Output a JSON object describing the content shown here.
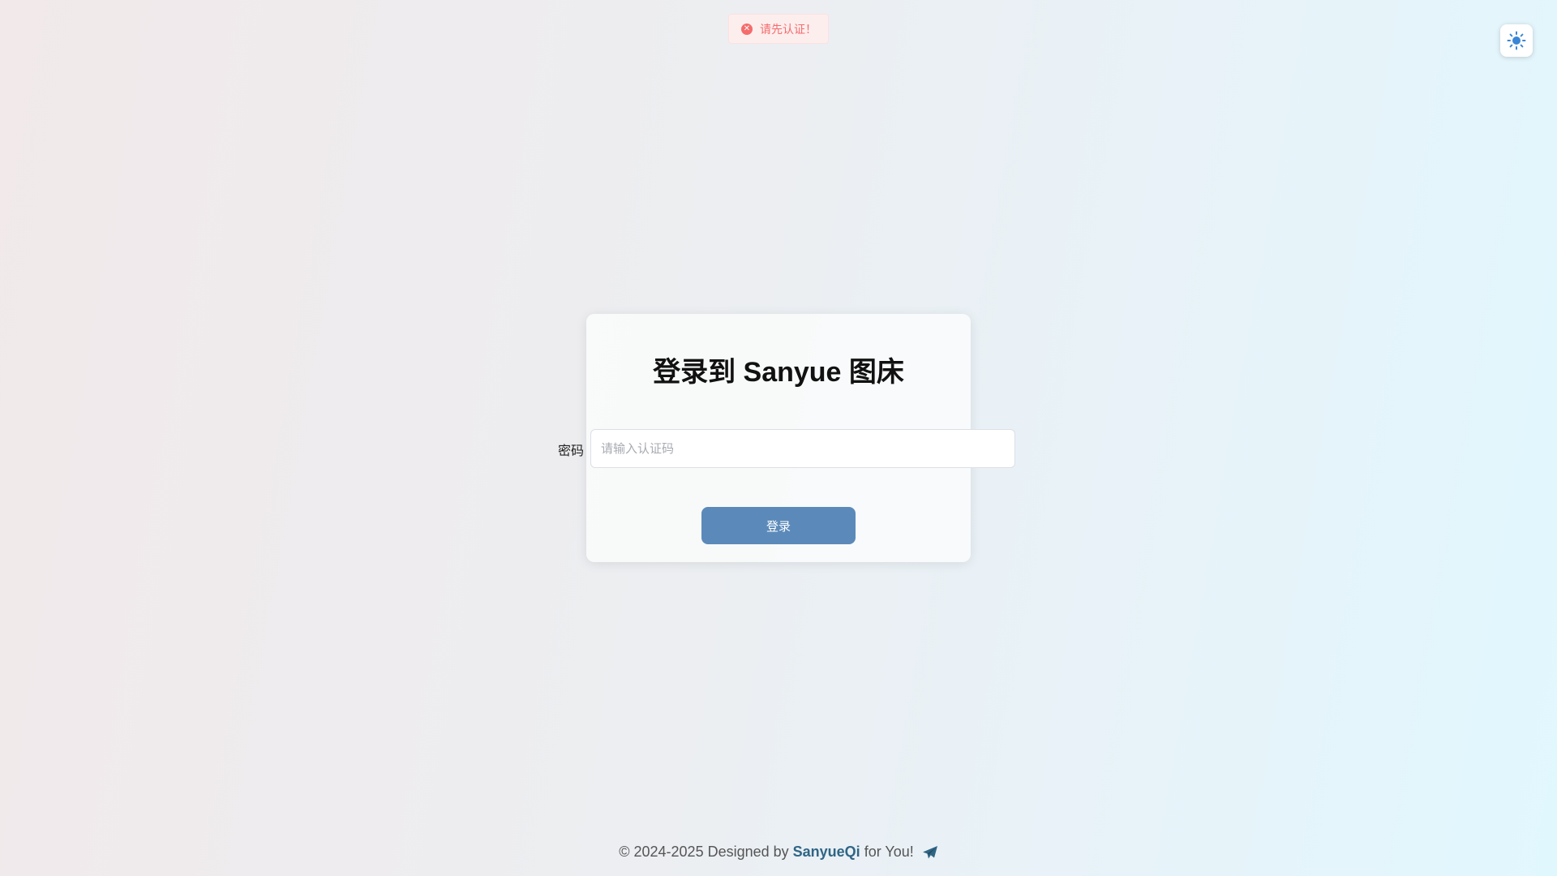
{
  "toast": {
    "message": "请先认证！",
    "icon": "error-circle-icon",
    "color": "#f56c6c"
  },
  "theme_toggle": {
    "icon": "sun-icon",
    "color": "#3a86d6"
  },
  "login": {
    "title": "登录到 Sanyue 图床",
    "password_label": "密码",
    "password_value": "",
    "password_placeholder": "请输入认证码",
    "submit_label": "登录",
    "button_color": "#5b8aba"
  },
  "footer": {
    "prefix": "© 2024-2025 Designed by",
    "author": "SanyueQi",
    "suffix": "for You!",
    "icon": "paper-plane-icon",
    "accent": "#2f6585"
  }
}
